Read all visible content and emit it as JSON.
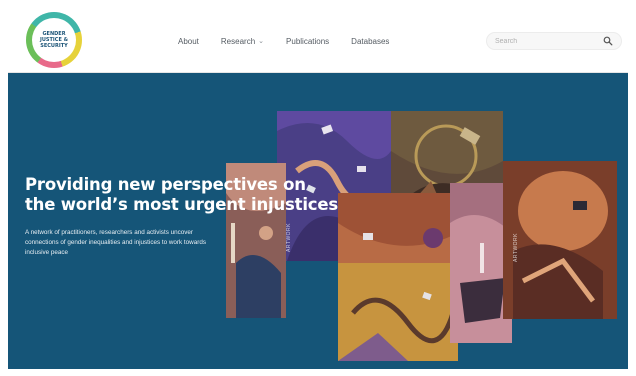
{
  "logo": {
    "line1": "GENDER",
    "line2": "JUSTICE &",
    "line3": "SECURITY"
  },
  "nav": {
    "items": [
      {
        "label": "About",
        "has_dropdown": false
      },
      {
        "label": "Research",
        "has_dropdown": true
      },
      {
        "label": "Publications",
        "has_dropdown": false
      },
      {
        "label": "Databases",
        "has_dropdown": false
      }
    ]
  },
  "search": {
    "placeholder": "Search",
    "icon": "search-icon"
  },
  "hero": {
    "title_line1": "Providing new perspectives on",
    "title_line2": "the world’s most urgent injustices",
    "subtitle_line1": "A network of practitioners, researchers and activists uncover",
    "subtitle_line2": "connections of gender inequalities and injustices to work towards",
    "subtitle_line3": "inclusive peace"
  },
  "colors": {
    "hero_bg": "#155578",
    "header_bg": "#ffffff",
    "nav_text": "#555c63",
    "logo_text": "#1d5578"
  }
}
